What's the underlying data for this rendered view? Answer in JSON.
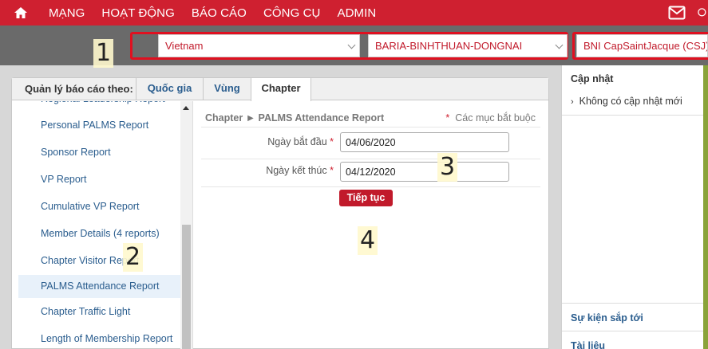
{
  "nav": {
    "items": [
      "MẠNG",
      "HOẠT ĐỘNG",
      "BÁO CÁO",
      "CÔNG CỤ",
      "ADMIN"
    ]
  },
  "selectors": {
    "country": "Vietnam",
    "region": "BARIA-BINHTHUAN-DONGNAI",
    "chapter": "BNI CapSaintJacque (CSJ)"
  },
  "markers": [
    "1",
    "2",
    "3",
    "4"
  ],
  "tabs": {
    "label": "Quản lý báo cáo theo:",
    "items": [
      "Quốc gia",
      "Vùng",
      "Chapter"
    ],
    "active": "Chapter"
  },
  "reports": [
    "Regional Leadership Report",
    "Personal PALMS Report",
    "Sponsor Report",
    "VP Report",
    "Cumulative VP Report",
    "Member Details (4 reports)",
    "Chapter Visitor Report",
    "PALMS Attendance Report",
    "Chapter Traffic Light",
    "Length of Membership Report"
  ],
  "selected_report": "PALMS Attendance Report",
  "form": {
    "breadcrumb": "Chapter ► PALMS Attendance Report",
    "required_note": "Các mục bắt buộc",
    "required_star": "*",
    "start_label": "Ngày bắt đầu",
    "start_value": "04/06/2020",
    "end_label": "Ngày kết thúc",
    "end_value": "04/12/2020",
    "submit": "Tiếp tục"
  },
  "sidebar": {
    "updates_title": "Cập nhật",
    "updates_item": "Không có cập nhật mới",
    "events_title": "Sự kiện sắp tới",
    "docs_title": "Tài liệu"
  },
  "colors": {
    "brand_red": "#cf2030",
    "link_blue": "#2a5d8e",
    "highlight_red": "#e01020"
  }
}
